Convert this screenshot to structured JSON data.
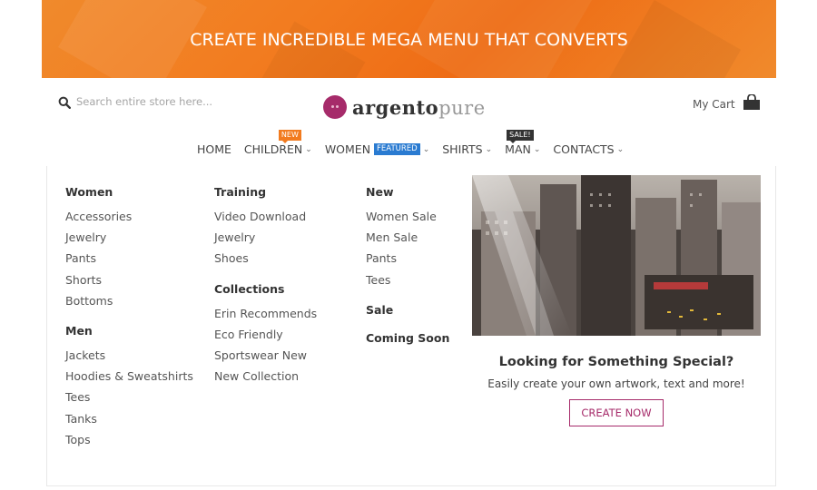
{
  "banner": {
    "text": "CREATE INCREDIBLE MEGA MENU THAT CONVERTS"
  },
  "header": {
    "search_placeholder": "Search entire store here...",
    "logo": {
      "bold": "argento",
      "light": "pure"
    },
    "cart_label": "My Cart"
  },
  "nav": {
    "items": [
      {
        "label": "HOME"
      },
      {
        "label": "CHILDREN",
        "badge": "NEW"
      },
      {
        "label": "WOMEN",
        "badge": "FEATURED"
      },
      {
        "label": "SHIRTS"
      },
      {
        "label": "MAN",
        "badge": "SALE!"
      },
      {
        "label": "CONTACTS"
      }
    ]
  },
  "mega": {
    "col1": {
      "women_head": "Women",
      "women_links": [
        "Accessories",
        "Jewelry",
        "Pants",
        "Shorts",
        "Bottoms"
      ],
      "men_head": "Men",
      "men_links": [
        "Jackets",
        "Hoodies & Sweatshirts",
        "Tees",
        "Tanks",
        "Tops"
      ]
    },
    "col2": {
      "training_head": "Training",
      "training_links": [
        "Video Download",
        "Jewelry",
        "Shoes"
      ],
      "collections_head": "Collections",
      "collections_links": [
        "Erin Recommends",
        "Eco Friendly",
        "Sportswear New",
        "New Collection"
      ]
    },
    "col3": {
      "new_head": "New",
      "new_links": [
        "Women Sale",
        "Men Sale",
        "Pants",
        "Tees"
      ],
      "sale_head": "Sale",
      "coming_soon": "Coming Soon"
    },
    "promo": {
      "title": "Looking for Something Special?",
      "subtitle": "Easily create your own artwork, text and more!",
      "button": "CREATE NOW"
    }
  },
  "colors": {
    "accent": "#a62b6a",
    "banner": "#f27b1f",
    "featured": "#2a7bd1"
  }
}
